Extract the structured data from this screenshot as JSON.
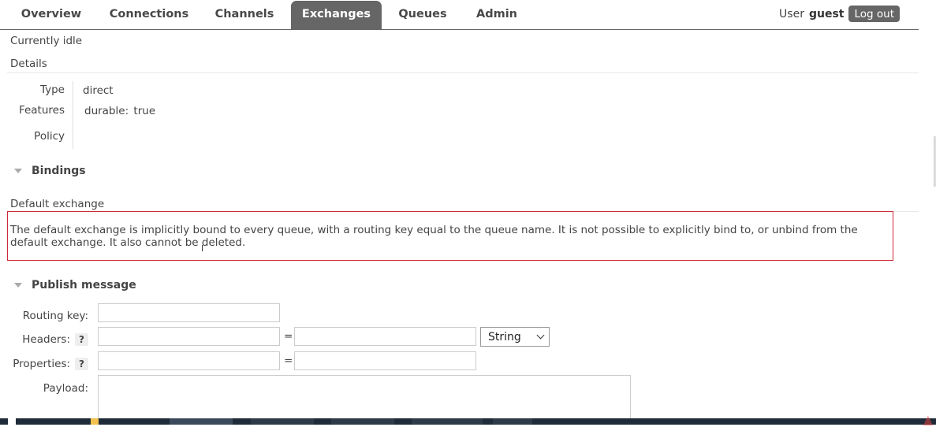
{
  "nav": {
    "tabs": [
      {
        "label": "Overview",
        "active": false
      },
      {
        "label": "Connections",
        "active": false
      },
      {
        "label": "Channels",
        "active": false
      },
      {
        "label": "Exchanges",
        "active": true
      },
      {
        "label": "Queues",
        "active": false
      },
      {
        "label": "Admin",
        "active": false
      }
    ],
    "user_prefix": "User",
    "user_name": "guest",
    "logout_label": "Log out"
  },
  "status": "Currently idle",
  "details": {
    "heading": "Details",
    "type_label": "Type",
    "type_value": "direct",
    "features_label": "Features",
    "features_key": "durable:",
    "features_value": "true",
    "policy_label": "Policy"
  },
  "bindings": {
    "heading": "Bindings",
    "subheading": "Default exchange",
    "description": "The default exchange is implicitly bound to every queue, with a routing key equal to the queue name. It is not possible to explicitly bind to, or unbind from the default exchange. It also cannot be deleted."
  },
  "publish": {
    "heading": "Publish message",
    "routing_key_label": "Routing key:",
    "headers_label": "Headers:",
    "properties_label": "Properties:",
    "payload_label": "Payload:",
    "help_glyph": "?",
    "equals": "=",
    "header_type_selected": "String"
  },
  "colors": {
    "active_tab": "#666666",
    "highlight_border": "#cc2a3b"
  }
}
